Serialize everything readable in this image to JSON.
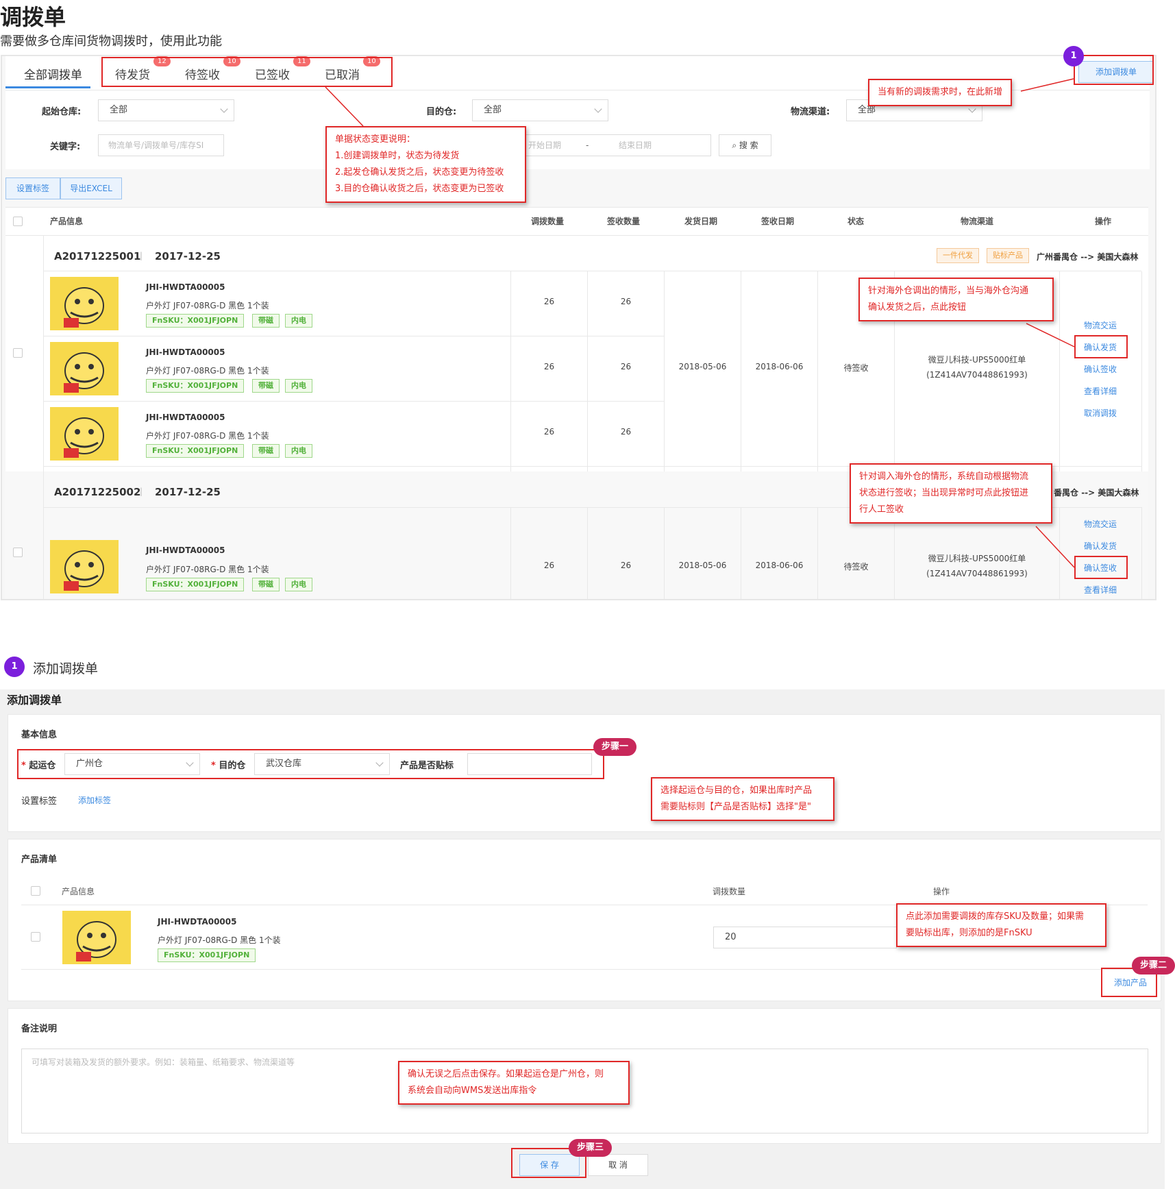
{
  "page": {
    "title": "调拨单",
    "subtitle": "需要做多仓库间货物调拨时，使用此功能"
  },
  "tabs": [
    {
      "label": "全部调拨单",
      "badge": ""
    },
    {
      "label": "待发货",
      "badge": "12"
    },
    {
      "label": "待签收",
      "badge": "10"
    },
    {
      "label": "已签收",
      "badge": "11"
    },
    {
      "label": "已取消",
      "badge": "10"
    }
  ],
  "toolbar": {
    "add_label": "添加调拨单",
    "set_tag_label": "设置标签",
    "export_label": "导出EXCEL"
  },
  "filters": {
    "origin_label": "起始仓库:",
    "origin_value": "全部",
    "dest_label": "目的仓:",
    "dest_value": "全部",
    "channel_label": "物流渠道:",
    "channel_value": "全部",
    "keyword_label": "关键字:",
    "keyword_placeholder": "物流单号/调拨单号/库存SI",
    "start_date_placeholder": "开始日期",
    "date_sep": "-",
    "end_date_placeholder": "结束日期",
    "search_label": "搜 索"
  },
  "table": {
    "headers": [
      "产品信息",
      "调拨数量",
      "签收数量",
      "发货日期",
      "签收日期",
      "状态",
      "物流渠道",
      "操作"
    ]
  },
  "orders": [
    {
      "order_no": "A20171225001",
      "sep": "|",
      "date": "2017-12-25",
      "tag1": "一件代发",
      "tag2": "贴标产品",
      "route_from": "广州番禺仓",
      "route_arrow": "-->",
      "route_to": "美国大森林",
      "ship_date": "2018-05-06",
      "sign_date": "2018-06-06",
      "status": "待签收",
      "channel": "微豆儿科技-UPS5000红单",
      "tracking": "(1Z414AV70448861993)",
      "actions": [
        "物流交运",
        "确认发货",
        "确认签收",
        "查看详细",
        "取消调拨"
      ],
      "items": [
        {
          "sku": "JHI-HWDTA00005",
          "name": "户外灯 JF07-08RG-D 黑色 1个装",
          "fnsku": "FnSKU：X001JFJOPN",
          "t1": "带磁",
          "t2": "内电",
          "qty": "26",
          "signed": "26"
        },
        {
          "sku": "JHI-HWDTA00005",
          "name": "户外灯 JF07-08RG-D 黑色 1个装",
          "fnsku": "FnSKU：X001JFJOPN",
          "t1": "带磁",
          "t2": "内电",
          "qty": "26",
          "signed": "26"
        },
        {
          "sku": "JHI-HWDTA00005",
          "name": "户外灯 JF07-08RG-D 黑色 1个装",
          "fnsku": "FnSKU：X001JFJOPN",
          "t1": "带磁",
          "t2": "内电",
          "qty": "26",
          "signed": "26"
        }
      ]
    },
    {
      "order_no": "A20171225002",
      "sep": "|",
      "date": "2017-12-25",
      "route_from": "番禺仓",
      "route_arrow": "-->",
      "route_to": "美国大森林",
      "ship_date": "2018-05-06",
      "sign_date": "2018-06-06",
      "status": "待签收",
      "channel": "微豆儿科技-UPS5000红单",
      "tracking": "(1Z414AV70448861993)",
      "actions": [
        "物流交运",
        "确认发货",
        "确认签收",
        "查看详细"
      ],
      "items": [
        {
          "sku": "JHI-HWDTA00005",
          "name": "户外灯 JF07-08RG-D 黑色 1个装",
          "fnsku": "FnSKU：X001JFJOPN",
          "t1": "带磁",
          "t2": "内电",
          "qty": "26",
          "signed": "26"
        }
      ]
    }
  ],
  "callouts": {
    "add_new": "当有新的调拨需求时，在此新增",
    "status_title": "单据状态变更说明：",
    "status_1": "1.创建调拨单时，状态为待发货",
    "status_2": "2.起发仓确认发货之后，状态变更为待签收",
    "status_3": "3.目的仓确认收货之后，状态变更为已签收",
    "ship_1": "针对海外仓调出的情形，当与海外仓沟通",
    "ship_2": "确认发货之后，点此按钮",
    "sign_1": "针对调入海外仓的情形，系统自动根据物流",
    "sign_2": "状态进行签收；当出现异常时可点此按钮进",
    "sign_3": "行人工签收"
  },
  "marker": {
    "number": "1"
  },
  "section2": {
    "marker_number": "1",
    "heading": "添加调拨单",
    "form_title": "添加调拨单",
    "basic_info": "基本信息",
    "origin_label": "起运仓",
    "origin_value": "广州仓",
    "dest_label": "目的仓",
    "dest_value": "武汉仓库",
    "label_q": "产品是否贴标",
    "set_tag": "设置标签",
    "add_tag": "添加标签",
    "step1": "步骤一",
    "step2": "步骤二",
    "step3": "步骤三",
    "c1_1": "选择起运仓与目的仓，如果出库时产品",
    "c1_2": "需要贴标则【产品是否贴标】选择\"是\"",
    "product_list": "产品清单",
    "col_info": "产品信息",
    "col_qty": "调拨数量",
    "col_op": "操作",
    "item_sku": "JHI-HWDTA00005",
    "item_name": "户外灯 JF07-08RG-D 黑色 1个装",
    "item_fnsku": "FnSKU：X001JFJOPN",
    "item_qty": "20",
    "c2_1": "点此添加需要调拨的库存SKU及数量；如果需",
    "c2_2": "要贴标出库，则添加的是FnSKU",
    "add_product": "添加产品",
    "remark_title": "备注说明",
    "remark_placeholder": "可填写对装箱及发货的额外要求。例如：装箱量、纸箱要求、物流渠道等",
    "c3_1": "确认无误之后点击保存。如果起运仓是广州仓，则",
    "c3_2": "系统会自动向WMS发送出库指令",
    "save": "保 存",
    "cancel": "取 消"
  }
}
